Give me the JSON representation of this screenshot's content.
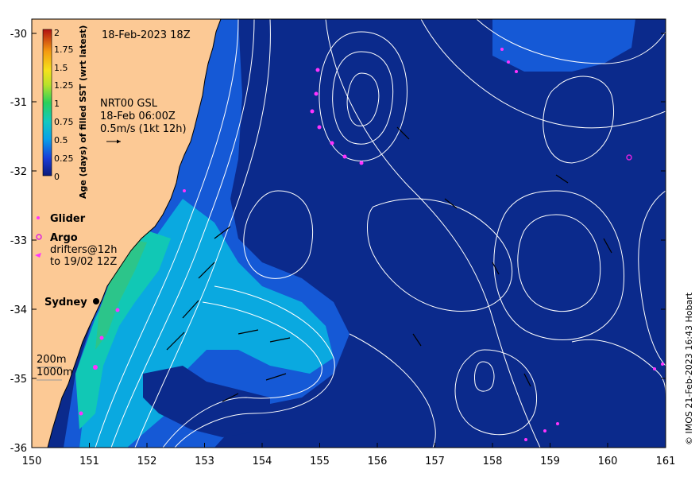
{
  "map": {
    "timestamp": "18-Feb-2023 18Z",
    "product_line1": "NRT00 GSL",
    "product_line2": "18-Feb 06:00Z",
    "scale_text": "0.5m/s (1kt 12h)",
    "city": "Sydney",
    "depth_200": "200m",
    "depth_1000": "1000m",
    "credit": "© IMOS 21-Feb-2023 16:43 Hobart"
  },
  "legend": {
    "glider": "Glider",
    "argo": "Argo",
    "drifters_line1": "drifters@12h",
    "drifters_line2": "to 19/02 12Z"
  },
  "colorbar": {
    "title": "Age (days) of filled SST (wrt latest)",
    "ticks": [
      "2",
      "1.75",
      "1.5",
      "1.25",
      "1",
      "0.75",
      "0.5",
      "0.25",
      "0"
    ]
  },
  "axes": {
    "lon_ticks": [
      "150",
      "151",
      "152",
      "153",
      "154",
      "155",
      "156",
      "157",
      "158",
      "159",
      "160",
      "161"
    ],
    "lat_ticks": [
      "-30",
      "-31",
      "-32",
      "-33",
      "-34",
      "-35",
      "-36"
    ]
  },
  "colors": {
    "land": "#fcc995",
    "ocean_age0": "#0b2a8c",
    "ocean_age025": "#1559d6",
    "ocean_age05": "#0aa9e0",
    "ocean_age075": "#11c8b5",
    "contour": "#ffffff",
    "drifter": "#ff33ff",
    "argo": "#dd22dd"
  }
}
